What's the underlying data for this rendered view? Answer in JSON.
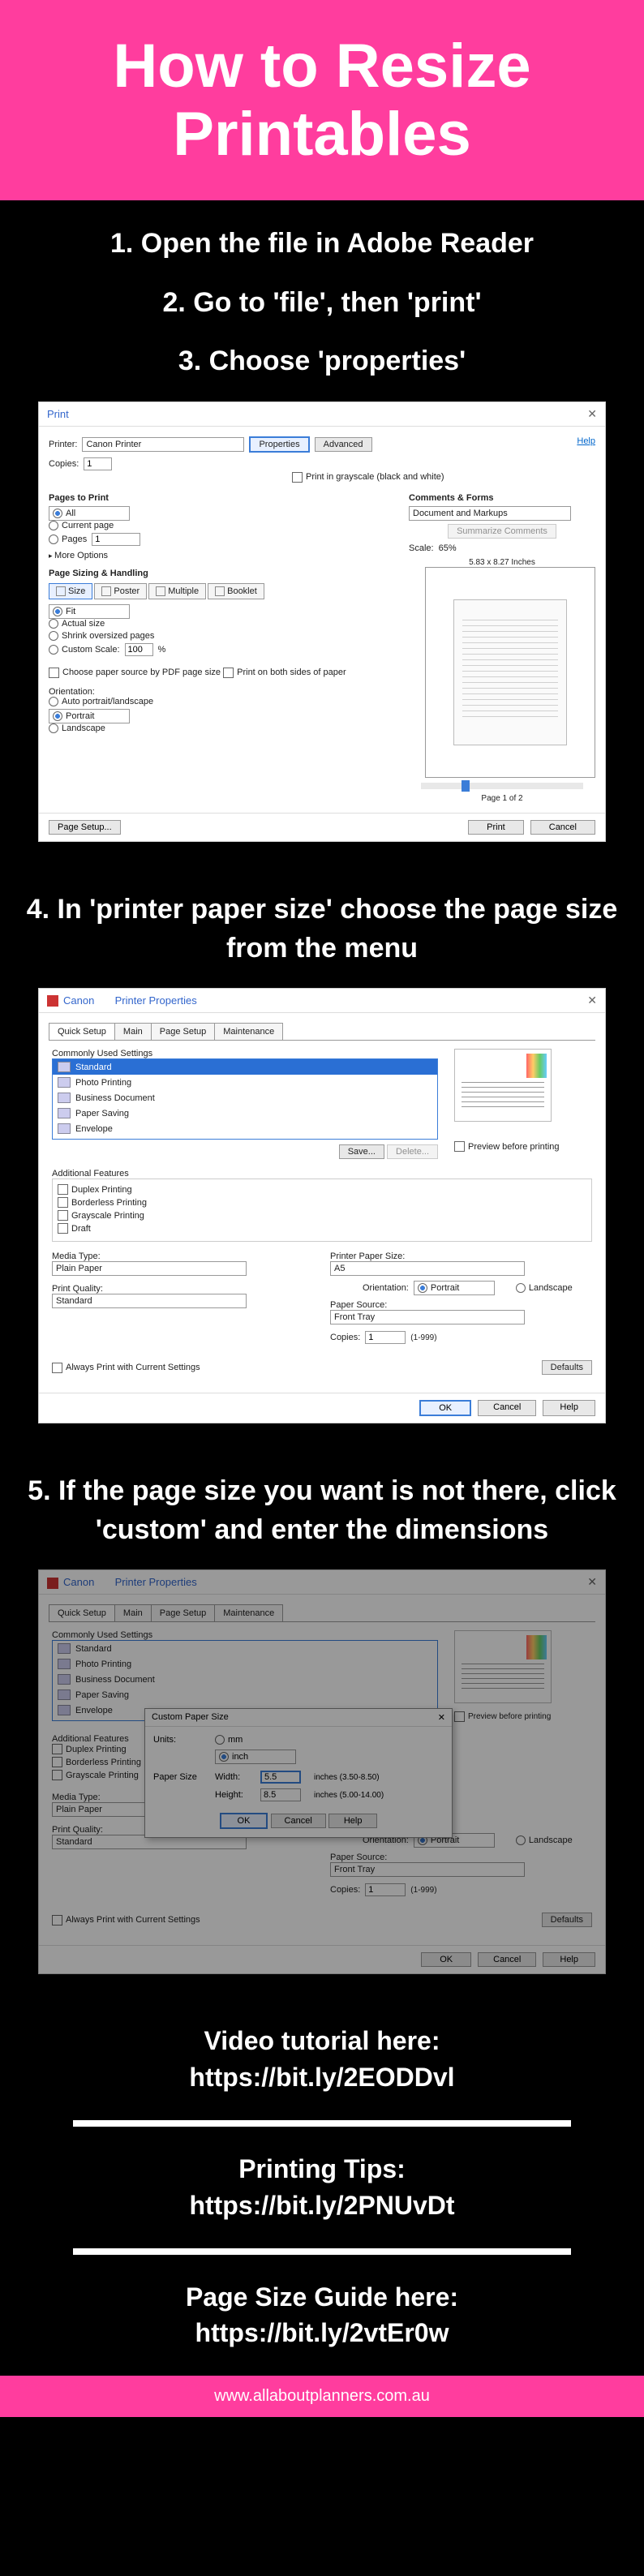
{
  "header": {
    "title": "How to Resize Printables"
  },
  "steps": {
    "s1": "1. Open the file in Adobe Reader",
    "s2": "2. Go to 'file', then 'print'",
    "s3": "3. Choose 'properties'",
    "s4": "4. In 'printer paper size' choose the page size from the menu",
    "s5": "5. If the page size you want is not there, click 'custom' and enter the dimensions"
  },
  "print_dialog": {
    "title": "Print",
    "help": "Help",
    "printer_lbl": "Printer:",
    "printer_val": "Canon                Printer",
    "copies_lbl": "Copies:",
    "copies_val": "1",
    "properties_btn": "Properties",
    "advanced_btn": "Advanced",
    "grayscale": "Print in grayscale (black and white)",
    "pages_to_print": "Pages to Print",
    "all": "All",
    "current": "Current page",
    "pages": "Pages",
    "pages_val": "1",
    "more_opts": "More Options",
    "comments_forms": "Comments & Forms",
    "comments_val": "Document and Markups",
    "summarize": "Summarize Comments",
    "scale_lbl": "Scale:",
    "scale_val": "65%",
    "sizing": "Page Sizing & Handling",
    "size_tab": "Size",
    "poster_tab": "Poster",
    "multiple_tab": "Multiple",
    "booklet_tab": "Booklet",
    "fit": "Fit",
    "actual": "Actual size",
    "shrink": "Shrink oversized pages",
    "custom_scale": "Custom Scale:",
    "custom_val": "100",
    "percent": "%",
    "pdf_source": "Choose paper source by PDF page size",
    "both_sides": "Print on both sides of paper",
    "orientation": "Orientation:",
    "auto_orient": "Auto portrait/landscape",
    "portrait": "Portrait",
    "landscape": "Landscape",
    "dims": "5.83 x 8.27 Inches",
    "page_count": "Page 1 of 2",
    "page_setup": "Page Setup...",
    "print_btn": "Print",
    "cancel_btn": "Cancel"
  },
  "props_dialog": {
    "brand": "Canon",
    "title": "Printer Properties",
    "tab_quick": "Quick Setup",
    "tab_main": "Main",
    "tab_page": "Page Setup",
    "tab_maint": "Maintenance",
    "commonly": "Commonly Used Settings",
    "item_standard": "Standard",
    "item_photo": "Photo Printing",
    "item_business": "Business Document",
    "item_saving": "Paper Saving",
    "item_envelope": "Envelope",
    "save_btn": "Save...",
    "delete_btn": "Delete...",
    "preview_chk": "Preview before printing",
    "additional": "Additional Features",
    "duplex": "Duplex Printing",
    "borderless": "Borderless Printing",
    "grayscale": "Grayscale Printing",
    "draft": "Draft",
    "media_type": "Media Type:",
    "media_val": "Plain Paper",
    "quality": "Print Quality:",
    "quality_val": "Standard",
    "paper_size": "Printer Paper Size:",
    "paper_val": "A5",
    "orientation": "Orientation:",
    "portrait": "Portrait",
    "landscape": "Landscape",
    "source": "Paper Source:",
    "source_val": "Front Tray",
    "copies_lbl": "Copies:",
    "copies_val": "1",
    "copies_range": "(1-999)",
    "always": "Always Print with Current Settings",
    "defaults": "Defaults",
    "ok": "OK",
    "cancel": "Cancel",
    "help": "Help"
  },
  "custom_popup": {
    "title": "Custom Paper Size",
    "units": "Units:",
    "mm": "mm",
    "inch": "inch",
    "paper_size": "Paper Size",
    "width": "Width:",
    "width_val": "5.5",
    "width_range": "inches (3.50-8.50)",
    "height": "Height:",
    "height_val": "8.5",
    "height_range": "inches (5.00-14.00)",
    "ok": "OK",
    "cancel": "Cancel",
    "help": "Help"
  },
  "footer": {
    "video_l1": "Video tutorial here:",
    "video_l2": "https://bit.ly/2EODDvl",
    "tips_l1": "Printing Tips:",
    "tips_l2": "https://bit.ly/2PNUvDt",
    "guide_l1": "Page Size Guide here:",
    "guide_l2": "https://bit.ly/2vtEr0w",
    "url": "www.allaboutplanners.com.au"
  }
}
